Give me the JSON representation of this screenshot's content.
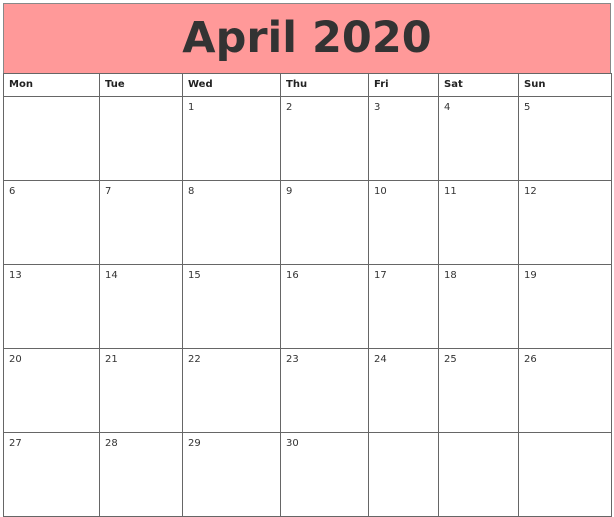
{
  "header": {
    "title": "April 2020",
    "background": "#ff9999",
    "text_color": "#333333"
  },
  "weekdays": [
    "Mon",
    "Tue",
    "Wed",
    "Thu",
    "Fri",
    "Sat",
    "Sun"
  ],
  "weeks": [
    [
      "",
      "",
      "1",
      "2",
      "3",
      "4",
      "5"
    ],
    [
      "6",
      "7",
      "8",
      "9",
      "10",
      "11",
      "12"
    ],
    [
      "13",
      "14",
      "15",
      "16",
      "17",
      "18",
      "19"
    ],
    [
      "20",
      "21",
      "22",
      "23",
      "24",
      "25",
      "26"
    ],
    [
      "27",
      "28",
      "29",
      "30",
      "",
      "",
      ""
    ]
  ]
}
